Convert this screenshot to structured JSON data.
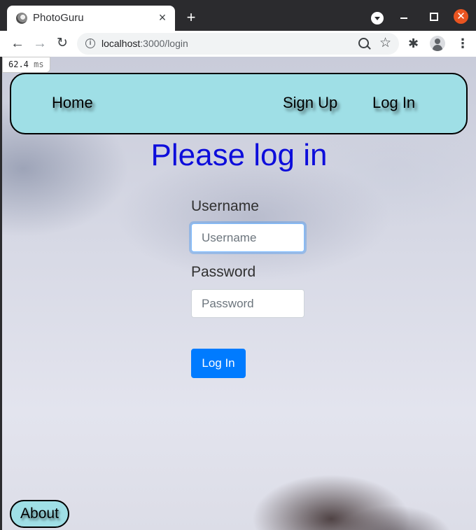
{
  "browser": {
    "tab": {
      "title": "PhotoGuru",
      "favicon_icon": "photoguru-logo-icon",
      "close_glyph": "×"
    },
    "new_tab_glyph": "+",
    "window_controls": {
      "close_glyph": "✕",
      "close_color": "#e95420"
    },
    "toolbar": {
      "back_glyph": "←",
      "forward_glyph": "→",
      "reload_glyph": "↻",
      "info_glyph": "i",
      "url_host": "localhost",
      "url_path": ":3000/login",
      "star_glyph": "☆",
      "extensions_glyph": "✱",
      "menu_glyph": "⋮"
    }
  },
  "timing_badge": {
    "value": "62.4",
    "unit": "ms"
  },
  "navbar": {
    "background_color": "#9fdfe6",
    "home_label": "Home",
    "signup_label": "Sign Up",
    "login_label": "Log In"
  },
  "page": {
    "title": "Please log in",
    "title_color": "#0d0ddb"
  },
  "login_form": {
    "username_label": "Username",
    "username_placeholder": "Username",
    "username_value": "",
    "password_label": "Password",
    "password_placeholder": "Password",
    "password_value": "",
    "submit_label": "Log In",
    "submit_color": "#007bff"
  },
  "footer": {
    "about_label": "About"
  }
}
